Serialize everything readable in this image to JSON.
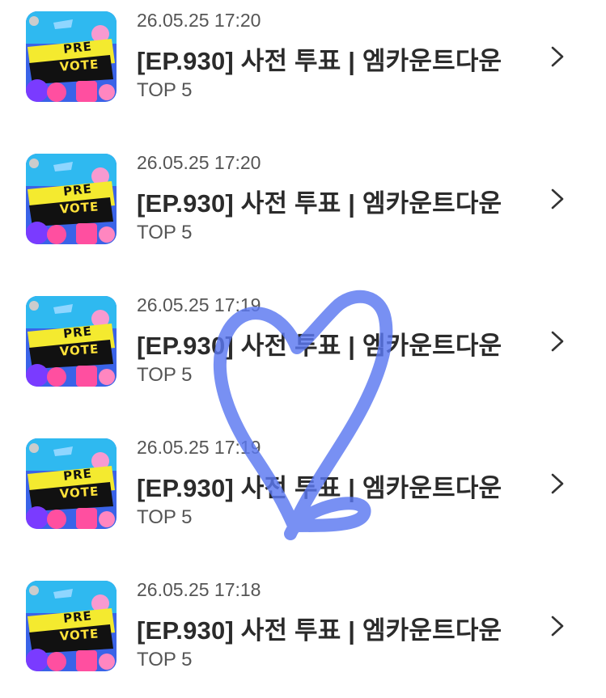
{
  "items": [
    {
      "date": "26.05.25 17:20",
      "title": "[EP.930] 사전 투표 | 엠카운트다운",
      "subtitle": "TOP 5",
      "thumb": {
        "line1": "PRE",
        "line2": "VOTE"
      }
    },
    {
      "date": "26.05.25 17:20",
      "title": "[EP.930] 사전 투표 | 엠카운트다운",
      "subtitle": "TOP 5",
      "thumb": {
        "line1": "PRE",
        "line2": "VOTE"
      }
    },
    {
      "date": "26.05.25 17:19",
      "title": "[EP.930] 사전 투표 | 엠카운트다운",
      "subtitle": "TOP 5",
      "thumb": {
        "line1": "PRE",
        "line2": "VOTE"
      }
    },
    {
      "date": "26.05.25 17:19",
      "title": "[EP.930] 사전 투표 | 엠카운트다운",
      "subtitle": "TOP 5",
      "thumb": {
        "line1": "PRE",
        "line2": "VOTE"
      }
    },
    {
      "date": "26.05.25 17:18",
      "title": "[EP.930] 사전 투표 | 엠카운트다운",
      "subtitle": "TOP 5",
      "thumb": {
        "line1": "PRE",
        "line2": "VOTE"
      }
    }
  ],
  "icons": {
    "chevron": "chevron-right-icon",
    "overlay": "hand-drawn-heart"
  },
  "colors": {
    "heart_stroke": "#5a78f0",
    "thumb_bg": "#3a63e8",
    "thumb_banner": "#f4ea2f",
    "thumb_accent_pink": "#ff4fa0",
    "title_text": "#2b2b2b",
    "meta_text": "#555555"
  }
}
